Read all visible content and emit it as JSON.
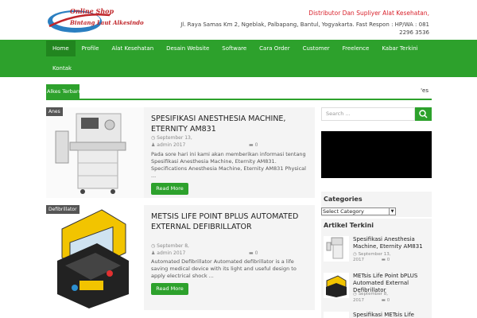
{
  "header": {
    "logo_line1": "Online Shop",
    "logo_line2": "Bintang Laut Alkesindo",
    "tagline": "Distributor Dan Supliyer Alat Kesehatan,",
    "address": "Jl. Raya Samas Km 2, Ngeblak, Palbapang, Bantul, Yogyakarta. Fast Respon : HP/WA : 081 2296 3536"
  },
  "nav": {
    "items": [
      "Home",
      "Profile",
      "Alat Kesehatan",
      "Desain Website",
      "Software",
      "Cara Order",
      "Customer",
      "Freelence",
      "Kabar Terkini",
      "Kontak"
    ]
  },
  "ticker": {
    "label": "Alkes Terbaru",
    "end_text": "'es"
  },
  "posts": [
    {
      "tag": "Anes",
      "title": "SPESIFIKASI ANESTHESIA MACHINE, ETERNITY AM831",
      "date": "September 13,",
      "author": "admin 2017",
      "comments": "0",
      "excerpt": "Pada sore hari ini kami akan memberikan informasi tentang Spesifikasi Anesthesia Machine, Eternity AM831. Specifications Anesthesia Machine, Eternity AM831 Physical ...",
      "button": "Read More"
    },
    {
      "tag": "Defibrillator",
      "title": "METSIS LIFE POINT BPLUS AUTOMATED EXTERNAL DEFIBRILLATOR",
      "date": "September 8,",
      "author": "admin 2017",
      "comments": "0",
      "excerpt": "Automated Defibrillator Automated defibrillator is a life saving medical device with its light and useful design to apply electrical shock ...",
      "button": "Read More"
    }
  ],
  "sidebar": {
    "search_placeholder": "Search ...",
    "categories_title": "Categories",
    "select_value": "Select Category",
    "recent_title": "Artikel Terkini",
    "recent": [
      {
        "title": "Spesifikasi Anesthesia Machine, Eternity AM831",
        "date": "September 13,",
        "year": "2017",
        "comments": "0"
      },
      {
        "title": "METsis Life Point bPLUS Automated External Defibrillator",
        "date": "September 8,",
        "year": "2017",
        "comments": "0"
      },
      {
        "title": "Spesifikasi METsis Life",
        "date": "",
        "year": "",
        "comments": ""
      }
    ]
  },
  "colors": {
    "accent": "#2da12c",
    "accent_dark": "#21851f",
    "brand_red": "#d9232d"
  }
}
